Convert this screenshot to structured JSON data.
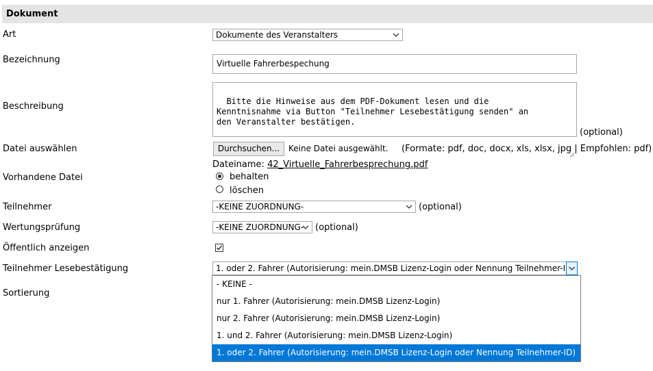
{
  "section": {
    "title": "Dokument"
  },
  "fields": {
    "art": {
      "label": "Art",
      "value": "Dokumente des Veranstalters"
    },
    "bezeichnung": {
      "label": "Bezeichnung",
      "value": "Virtuelle Fahrerbespechung"
    },
    "beschreibung": {
      "label": "Beschreibung",
      "value": "Bitte die Hinweise aus dem PDF-Dokument lesen und die\nKenntnisnahme via Button \"Teilnehmer Lesebestätigung senden\" an\nden Veranstalter bestätigen.",
      "note": "(optional)"
    },
    "datei": {
      "label": "Datei auswählen",
      "button": "Durchsuchen...",
      "status": "Keine Datei ausgewählt.",
      "formats": "(Formate: pdf, doc, docx, xls, xlsx, jpg | Empfohlen: pdf)",
      "filename_label": "Dateiname:",
      "filename": "42_Virtuelle_Fahrerbesprechung.pdf"
    },
    "vorhandene_datei": {
      "label": "Vorhandene Datei",
      "options": [
        "behalten",
        "löschen"
      ],
      "selected": "behalten"
    },
    "teilnehmer": {
      "label": "Teilnehmer",
      "value": "-KEINE ZUORDNUNG-",
      "note": "(optional)"
    },
    "wertungspruefung": {
      "label": "Wertungsprüfung",
      "value": "-KEINE ZUORDNUNG-",
      "note": "(optional)"
    },
    "oeffentlich": {
      "label": "Öffentlich anzeigen",
      "checked": true
    },
    "lesebestaetigung": {
      "label": "Teilnehmer Lesebestätigung",
      "value": "1. oder 2. Fahrer (Autorisierung: mein.DMSB Lizenz-Login oder Nennung Teilnehmer-ID)",
      "options": [
        "- KEINE -",
        "nur 1. Fahrer (Autorisierung: mein.DMSB Lizenz-Login)",
        "nur 2. Fahrer (Autorisierung: mein.DMSB Lizenz-Login)",
        "1. und 2. Fahrer (Autorisierung: mein.DMSB Lizenz-Login)",
        "1. oder 2. Fahrer (Autorisierung: mein.DMSB Lizenz-Login oder Nennung Teilnehmer-ID)"
      ],
      "selected_index": 4
    },
    "sortierung": {
      "label": "Sortierung"
    }
  },
  "icons": {
    "select": "chevron-down-icon",
    "check": "check-icon",
    "resize": "resize-grip-icon"
  },
  "colors": {
    "header_bg": "#e4e4e4",
    "selection": "#0078d7"
  }
}
